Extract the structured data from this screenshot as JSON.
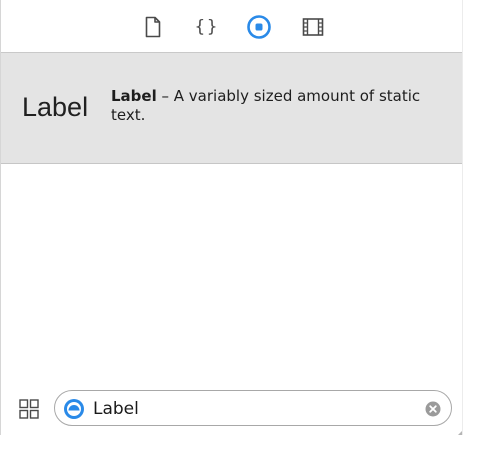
{
  "toolbar": {
    "tabs": [
      {
        "name": "file-template-library",
        "icon": "file-icon",
        "selected": false
      },
      {
        "name": "code-snippet-library",
        "icon": "braces-icon",
        "glyph": "{}",
        "selected": false
      },
      {
        "name": "object-library",
        "icon": "object-library-icon",
        "selected": true
      },
      {
        "name": "media-library",
        "icon": "film-icon",
        "selected": false
      }
    ]
  },
  "library_item": {
    "preview": "Label",
    "name": "Label",
    "description": " – A variably sized amount of static text."
  },
  "filter": {
    "value": "Label",
    "scope_icon": "object-scope-icon",
    "clear_icon": "clear-icon",
    "view_toggle_icon": "grid-view-icon"
  },
  "colors": {
    "accent": "#2a8ae8",
    "row_background": "#e4e4e4",
    "icon_gray": "#4a4a4a"
  }
}
